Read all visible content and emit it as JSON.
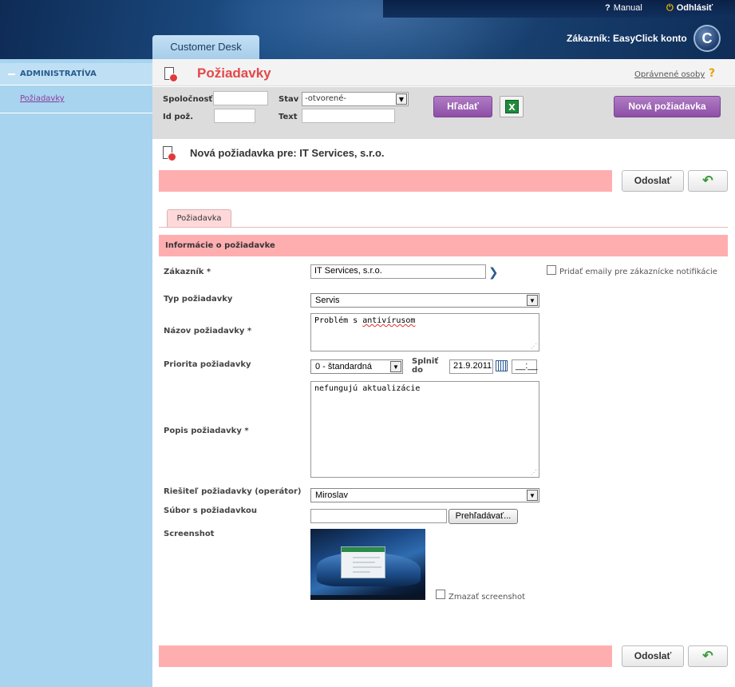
{
  "header": {
    "manual_label": "Manual",
    "logout_label": "Odhlásiť",
    "app_tab": "Customer Desk",
    "customer_label": "Zákazník: EasyClick konto",
    "logo_letter": "C",
    "colors": {
      "header_bg": "#1d4f86",
      "accent_purple": "#8d4fa6",
      "pink": "#ffaeb0",
      "title_red": "#e44848"
    }
  },
  "sidebar": {
    "section_label": "ADMINISTRATÍVA",
    "items": [
      {
        "label": "Požiadavky"
      }
    ]
  },
  "page": {
    "title": "Požiadavky",
    "authorized_link": "Oprávnené osoby",
    "help_icon": "?"
  },
  "filter": {
    "company_label": "Spoločnosť",
    "company_value": "",
    "status_label": "Stav",
    "status_value": "-otvorené-",
    "id_label": "Id pož.",
    "id_value": "",
    "text_label": "Text",
    "text_value": "",
    "search_button": "Hľadať",
    "excel_icon": "excel-icon",
    "new_request_button": "Nová požiadavka"
  },
  "form": {
    "subtitle": "Nová požiadavka pre: IT Services, s.r.o.",
    "submit_label": "Odoslať",
    "back_icon": "↶",
    "tab_label": "Požiadavka",
    "section_title": "Informácie o požiadavke",
    "customer_label": "Zákazník *",
    "customer_value": "IT Services, s.r.o.",
    "notify_label": "Pridať emaily pre zákaznícke notifikácie",
    "type_label": "Typ požiadavky",
    "type_value": "Servis",
    "name_label": "Názov požiadavky *",
    "name_value_prefix": "Problém s ",
    "name_value_misspelled": "antivírusom",
    "priority_label": "Priorita požiadavky",
    "priority_value": "0 - štandardná",
    "due_label_1": "Splniť",
    "due_label_2": "do",
    "due_date": "21.9.2011",
    "due_time": "__:__",
    "desc_label": "Popis požiadavky *",
    "desc_value": "nefungujú aktualizácie",
    "solver_label": "Riešiteľ požiadavky (operátor)",
    "solver_value": "Miroslav",
    "file_label": "Súbor s požiadavkou",
    "file_value": "",
    "browse_label": "Prehľadávať...",
    "screenshot_label": "Screenshot",
    "delete_screenshot_label": "Zmazať screenshot"
  }
}
